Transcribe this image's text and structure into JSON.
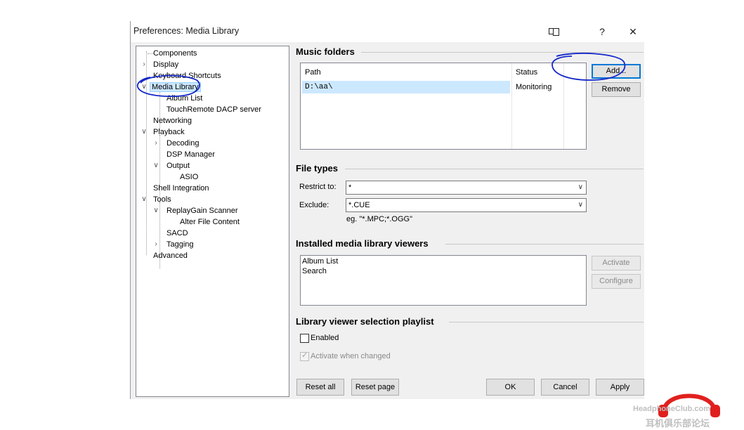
{
  "window": {
    "title": "Preferences: Media Library",
    "help_label": "?",
    "close_label": "✕"
  },
  "tree": [
    {
      "label": "Components"
    },
    {
      "label": "Display"
    },
    {
      "label": "Keyboard Shortcuts"
    },
    {
      "label": "Media Library",
      "selected": true
    },
    {
      "label": "Album List"
    },
    {
      "label": "TouchRemote DACP server"
    },
    {
      "label": "Networking"
    },
    {
      "label": "Playback"
    },
    {
      "label": "Decoding"
    },
    {
      "label": "DSP Manager"
    },
    {
      "label": "Output"
    },
    {
      "label": "ASIO"
    },
    {
      "label": "Shell Integration"
    },
    {
      "label": "Tools"
    },
    {
      "label": "ReplayGain Scanner"
    },
    {
      "label": "Alter File Content"
    },
    {
      "label": "SACD"
    },
    {
      "label": "Tagging"
    },
    {
      "label": "Advanced"
    }
  ],
  "music_folders": {
    "title": "Music folders",
    "columns": [
      "Path",
      "Status"
    ],
    "rows": [
      {
        "path": "D:\\aa\\",
        "status": "Monitoring"
      }
    ],
    "add_label": "Add...",
    "remove_label": "Remove"
  },
  "file_types": {
    "title": "File types",
    "restrict_label": "Restrict to:",
    "restrict_value": "*",
    "exclude_label": "Exclude:",
    "exclude_value": "*.CUE",
    "hint": "eg. \"*.MPC;*.OGG\""
  },
  "viewers": {
    "title": "Installed media library viewers",
    "items": [
      "Album List",
      "Search"
    ],
    "activate_label": "Activate",
    "configure_label": "Configure"
  },
  "playlist": {
    "title": "Library viewer selection playlist",
    "enabled_label": "Enabled",
    "activate_changed_label": "Activate when changed"
  },
  "footer": {
    "reset_all": "Reset all",
    "reset_page": "Reset page",
    "ok": "OK",
    "cancel": "Cancel",
    "apply": "Apply"
  },
  "watermark": {
    "line1": "HeadphoneClub.com",
    "line2": "耳机俱乐部论坛"
  },
  "colors": {
    "annotation": "#1428c8",
    "selection": "#cce8ff",
    "accent": "#0078d7",
    "watermark": "#e0201e"
  }
}
